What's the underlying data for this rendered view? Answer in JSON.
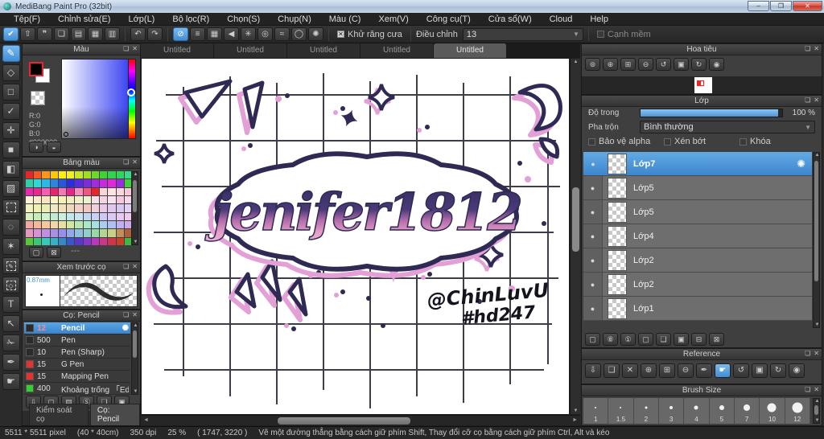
{
  "window": {
    "title": "MediBang Paint Pro (32bit)",
    "minimize": "–",
    "maximize": "❐",
    "close": "✕"
  },
  "menu": {
    "items": [
      "Tệp(F)",
      "Chỉnh sửa(E)",
      "Lớp(L)",
      "Bộ lọc(R)",
      "Chọn(S)",
      "Chụp(N)",
      "Màu (C)",
      "Xem(V)",
      "Công cụ(T)",
      "Cửa sổ(W)",
      "Cloud",
      "Help"
    ]
  },
  "toolbar": {
    "group1": [
      {
        "name": "brush-mode-icon",
        "glyph": "✔",
        "selected": true
      },
      {
        "name": "export-icon",
        "glyph": "⇧"
      },
      {
        "name": "comment-icon",
        "glyph": "❞"
      },
      {
        "name": "comment-box-icon",
        "glyph": "❏"
      },
      {
        "name": "document-icon",
        "glyph": "▤"
      },
      {
        "name": "panel-layout-icon",
        "glyph": "▦"
      },
      {
        "name": "grid-settings-icon",
        "glyph": "▥"
      }
    ],
    "group2": [
      {
        "name": "undo-icon",
        "glyph": "↶"
      },
      {
        "name": "redo-icon",
        "glyph": "↷"
      }
    ],
    "group3": [
      {
        "name": "snap-off-icon",
        "glyph": "⊘",
        "selected": true
      },
      {
        "name": "snap-parallel-icon",
        "glyph": "≡"
      },
      {
        "name": "snap-grid-icon",
        "glyph": "▦"
      },
      {
        "name": "snap-vanishing-icon",
        "glyph": "◀"
      },
      {
        "name": "snap-radial-icon",
        "glyph": "✳"
      },
      {
        "name": "snap-concentric-icon",
        "glyph": "◎"
      },
      {
        "name": "snap-curve-icon",
        "glyph": "≈"
      },
      {
        "name": "snap-ellipse-icon",
        "glyph": "◯"
      },
      {
        "name": "snap-settings-icon",
        "glyph": "✺"
      }
    ],
    "antialias_label": "Khử răng cưa",
    "antialias_checked": "✕",
    "adjust_label": "Điều chỉnh",
    "adjust_value": "13",
    "soft_edge_label": "Cạnh mềm"
  },
  "tools": [
    {
      "name": "brush-tool",
      "glyph": "✎",
      "selected": true
    },
    {
      "name": "eraser-tool",
      "glyph": "◇"
    },
    {
      "name": "shape-brush-tool",
      "glyph": "□"
    },
    {
      "name": "polyline-tool",
      "glyph": "✓"
    },
    {
      "name": "move-tool",
      "glyph": "✛"
    },
    {
      "name": "fill-shape-tool",
      "glyph": "■"
    },
    {
      "name": "bucket-tool",
      "glyph": "◧"
    },
    {
      "name": "gradient-tool",
      "glyph": "▨"
    },
    {
      "name": "select-rect-tool",
      "glyph": "",
      "dashed": true
    },
    {
      "name": "lasso-tool",
      "glyph": "◌"
    },
    {
      "name": "magic-wand-tool",
      "glyph": "✶"
    },
    {
      "name": "select-pen-tool",
      "glyph": "✎",
      "dashed": true
    },
    {
      "name": "select-eraser-tool",
      "glyph": "◇",
      "dashed": true
    },
    {
      "name": "text-tool",
      "glyph": "T"
    },
    {
      "name": "operation-tool",
      "glyph": "↖"
    },
    {
      "name": "divide-tool",
      "glyph": "✁"
    },
    {
      "name": "eyedropper-tool",
      "glyph": "✒"
    },
    {
      "name": "hand-tool",
      "glyph": "☛"
    }
  ],
  "color_panel": {
    "title": "Màu",
    "r": "R:0",
    "g": "G:0",
    "b": "B:0",
    "hex": "#000000",
    "buttons": [
      {
        "name": "color-wheel-icon",
        "glyph": "◑"
      },
      {
        "name": "color-edit-icon",
        "glyph": "◒"
      }
    ]
  },
  "palette_panel": {
    "title": "Bảng màu",
    "empty_label": "---",
    "tools": [
      {
        "name": "add-color-icon",
        "glyph": "▢"
      },
      {
        "name": "delete-color-icon",
        "glyph": "⊠"
      }
    ],
    "rows": [
      [
        "#e8252a",
        "#f3591f",
        "#f9981d",
        "#fdc60b",
        "#fdee10",
        "#f0ef22",
        "#c4e822",
        "#9fdf1f",
        "#6fd828",
        "#3ed42f",
        "#2fd34d",
        "#2ed759",
        "#31dd8d"
      ],
      [
        "#2fd0a8",
        "#2fd8d8",
        "#2bb7e8",
        "#2a86e0",
        "#2a56d8",
        "#2a2ee0",
        "#5a2ae0",
        "#7e2ae0",
        "#a22ae0",
        "#c62ae0",
        "#e02ad8",
        "#9b2ce2",
        "#3bd337"
      ],
      [
        "#e82ab0",
        "#e82a8c",
        "#f45fb4",
        "#e8256e",
        "#f27ab4",
        "#e8258c",
        "#f78cbf",
        "#f2567e",
        "#e8252a",
        "#fbd5d8",
        "#fce4e6",
        "#fad8e2",
        "#f8c8d8"
      ],
      [
        "#fdf3d8",
        "#fdeccb",
        "#fce5c0",
        "#fbf6c8",
        "#f9f3b5",
        "#f4edc2",
        "#eef3c8",
        "#e8f2d0",
        "#f6e0e8",
        "#f2d4e4",
        "#f8e2ee",
        "#f4c8e0",
        "#f8d8ea"
      ],
      [
        "#f3f2c0",
        "#eef0b2",
        "#e9edb8",
        "#f2e8c8",
        "#f0e2b8",
        "#ecd9c0",
        "#f2d0c8",
        "#f0c8c0",
        "#eed0dc",
        "#e8c8e4",
        "#e0c8ec",
        "#d8c8f0",
        "#e4d0f4"
      ],
      [
        "#d8f0c0",
        "#c8ecb8",
        "#d0f0d0",
        "#c0ecd0",
        "#c8f0e0",
        "#c0e8e8",
        "#c8e4f0",
        "#c0d8f0",
        "#c8d0f4",
        "#d0c8f4",
        "#dcc8f4",
        "#e8c8f0",
        "#f0c8ec"
      ],
      [
        "#f2a8a0",
        "#f4b898",
        "#f6c8a0",
        "#f2d8a8",
        "#e8e0a0",
        "#d0e8a0",
        "#b8e8b0",
        "#a8e8c8",
        "#a8e0e0",
        "#a8d0ec",
        "#b0c0f0",
        "#c0b0f0",
        "#d0a8ec"
      ],
      [
        "#e898c0",
        "#d890d8",
        "#c090e0",
        "#a890e8",
        "#9890e8",
        "#90a8e8",
        "#90c0e0",
        "#90d0c8",
        "#98d8a8",
        "#b0d890",
        "#c8d088",
        "#c09058",
        "#b06038"
      ],
      [
        "#58c838",
        "#38c878",
        "#38c8b8",
        "#38b0c8",
        "#3888c8",
        "#3858c8",
        "#5838c8",
        "#8838c8",
        "#b838c0",
        "#c83888",
        "#c83848",
        "#c84028",
        "#40b840"
      ]
    ]
  },
  "brush_preview_panel": {
    "title": "Xem trước cọ",
    "size_label": "0.87mm"
  },
  "brush_panel": {
    "title": "Cọ: Pencil",
    "brushes": [
      {
        "size": "12",
        "name": "Pencil",
        "chip": "#2b2b2b",
        "selected": true
      },
      {
        "size": "500",
        "name": "Pen",
        "chip": "#2b2b2b"
      },
      {
        "size": "10",
        "name": "Pen (Sharp)",
        "chip": "#2b2b2b"
      },
      {
        "size": "15",
        "name": "G Pen",
        "chip": "#e8312f"
      },
      {
        "size": "15",
        "name": "Mapping Pen",
        "chip": "#e8312f"
      },
      {
        "size": "400",
        "name": "Khoảng trống 「Edge |",
        "chip": "#2fd32f"
      }
    ],
    "tools": [
      {
        "name": "cloud-brush-icon",
        "glyph": "⇩"
      },
      {
        "name": "add-brush-icon",
        "glyph": "▢"
      },
      {
        "name": "add-brush-menu-icon",
        "glyph": "▤"
      },
      {
        "name": "script-brush-icon",
        "glyph": "Ⓢ"
      },
      {
        "name": "brush-folder-icon",
        "glyph": "❏"
      },
      {
        "name": "duplicate-brush-icon",
        "glyph": "▣"
      }
    ],
    "tabs": [
      {
        "label": "Kiểm soát cọ"
      },
      {
        "label": "Cọ: Pencil",
        "selected": true
      }
    ]
  },
  "canvas": {
    "tabs": [
      "Untitled",
      "Untitled",
      "Untitled",
      "Untitled",
      "Untitled"
    ],
    "active_tab": 4,
    "artwork_text": "jenifer1812",
    "signature_line1": "@ChinLuvU",
    "signature_line2": "#hd247"
  },
  "navigator_panel": {
    "title": "Hoa tiêu",
    "tools": [
      {
        "name": "zoom-original-icon",
        "glyph": "⊜"
      },
      {
        "name": "zoom-in-icon",
        "glyph": "⊕"
      },
      {
        "name": "zoom-fit-icon",
        "glyph": "⊞"
      },
      {
        "name": "zoom-out-icon",
        "glyph": "⊖"
      },
      {
        "name": "rotate-left-icon",
        "glyph": "↺"
      },
      {
        "name": "reset-view-icon",
        "glyph": "▣"
      },
      {
        "name": "rotate-right-icon",
        "glyph": "↻"
      },
      {
        "name": "lock-rotation-icon",
        "glyph": "◉"
      }
    ]
  },
  "layer_panel": {
    "title": "Lớp",
    "opacity_label": "Độ trong",
    "opacity_value": "100 %",
    "blend_label": "Pha trộn",
    "blend_value": "Bình thường",
    "checkboxes": [
      "Bảo vệ alpha",
      "Xén bớt",
      "Khóa"
    ],
    "layers": [
      {
        "name": "Lớp7",
        "selected": true
      },
      {
        "name": "Lớp5"
      },
      {
        "name": "Lớp5"
      },
      {
        "name": "Lớp4"
      },
      {
        "name": "Lớp2"
      },
      {
        "name": "Lớp2"
      },
      {
        "name": "Lớp1"
      }
    ],
    "gear_glyph": "✺",
    "tools": [
      {
        "name": "add-layer-icon",
        "glyph": "▢"
      },
      {
        "name": "add-8bit-layer-icon",
        "glyph": "⑧"
      },
      {
        "name": "add-1bit-layer-icon",
        "glyph": "①"
      },
      {
        "name": "add-layer-menu-icon",
        "glyph": "▢"
      },
      {
        "name": "layer-folder-icon",
        "glyph": "❏"
      },
      {
        "name": "duplicate-layer-icon",
        "glyph": "▣"
      },
      {
        "name": "merge-layer-icon",
        "glyph": "⊟"
      },
      {
        "name": "delete-layer-icon",
        "glyph": "⊠"
      }
    ]
  },
  "reference_panel": {
    "title": "Reference",
    "tools": [
      {
        "name": "cloud-import-icon",
        "glyph": "⇩"
      },
      {
        "name": "open-folder-icon",
        "glyph": "❏"
      },
      {
        "name": "close-ref-icon",
        "glyph": "✕"
      },
      {
        "name": "ref-zoom-in-icon",
        "glyph": "⊕"
      },
      {
        "name": "ref-zoom-fit-icon",
        "glyph": "⊞"
      },
      {
        "name": "ref-zoom-out-icon",
        "glyph": "⊖"
      },
      {
        "name": "ref-eyedropper-icon",
        "glyph": "✒"
      },
      {
        "name": "ref-hand-icon",
        "glyph": "☛",
        "selected": true
      },
      {
        "name": "ref-rotate-left-icon",
        "glyph": "↺"
      },
      {
        "name": "ref-reset-icon",
        "glyph": "▣"
      },
      {
        "name": "ref-rotate-right-icon",
        "glyph": "↻"
      },
      {
        "name": "ref-lock-icon",
        "glyph": "◉"
      }
    ]
  },
  "brush_size_panel": {
    "title": "Brush Size",
    "sizes": [
      {
        "label": "1",
        "dot": 2
      },
      {
        "label": "1.5",
        "dot": 2
      },
      {
        "label": "2",
        "dot": 3
      },
      {
        "label": "3",
        "dot": 4
      },
      {
        "label": "4",
        "dot": 5
      },
      {
        "label": "5",
        "dot": 6
      },
      {
        "label": "7",
        "dot": 8
      },
      {
        "label": "10",
        "dot": 11
      },
      {
        "label": "12",
        "dot": 13
      }
    ]
  },
  "status_bar": {
    "dimensions": "5511 * 5511 pixel",
    "size_cm": "(40 * 40cm)",
    "dpi": "350 dpi",
    "zoom": "25 %",
    "coords": "( 1747, 3220 )",
    "hint": "Vẽ một đường thẳng bằng cách giữ phím Shift, Thay đổi cỡ cọ bằng cách giữ phím Ctrl, Alt và kéo"
  },
  "panel_chrome": {
    "popup_glyph": "❏",
    "close_glyph": "✕"
  }
}
